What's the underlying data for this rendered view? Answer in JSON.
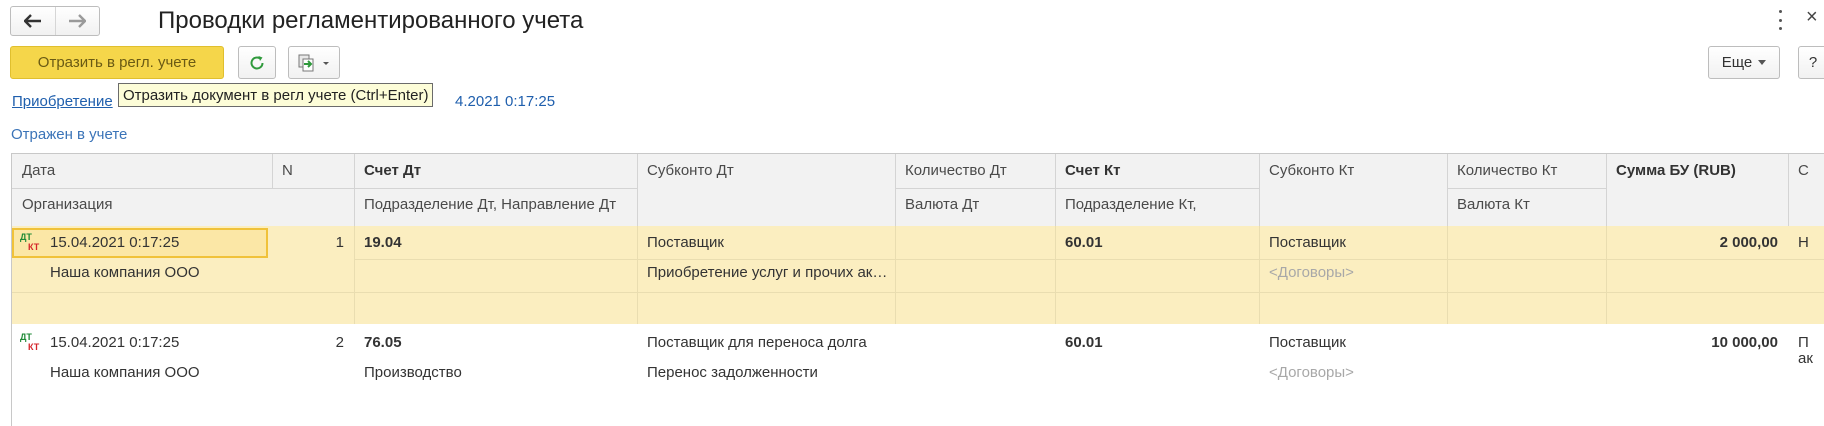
{
  "window": {
    "title": "Проводки регламентированного учета",
    "close_glyph": "×"
  },
  "toolbar": {
    "post_label": "Отразить в регл. учете",
    "more_label": "Еще",
    "help_label": "?"
  },
  "tooltip": "Отразить документ в регл учете (Ctrl+Enter)",
  "document_link": {
    "prefix": "Приобретение",
    "suffix": "4.2021 0:17:25"
  },
  "status": "Отражен в учете",
  "columns": {
    "date": "Дата",
    "n": "N",
    "debit_account": "Счет Дт",
    "debit_subconto": "Субконто Дт",
    "debit_qty": "Количество Дт",
    "credit_account": "Счет Кт",
    "credit_subconto": "Субконто Кт",
    "credit_qty": "Количество Кт",
    "amount": "Сумма БУ (RUB)",
    "extra": "С",
    "organization": "Организация",
    "debit_dept": "Подразделение Дт, Направление Дт",
    "debit_currency": "Валюта Дт",
    "credit_dept": "Подразделение Кт,",
    "credit_currency": "Валюта Кт"
  },
  "rows": [
    {
      "dtkt_dt": "ДТ",
      "dtkt_kt": "КТ",
      "date": "15.04.2021 0:17:25",
      "n": "1",
      "debit_account": "19.04",
      "organization": "Наша компания ООО",
      "debit_dept": "",
      "debit_subconto_1": "Поставщик",
      "debit_subconto_2": "Приобретение услуг и прочих ак…",
      "credit_account": "60.01",
      "credit_subconto_1": "Поставщик",
      "credit_subconto_2": "<Договоры>",
      "amount": "2 000,00",
      "extra": "Н"
    },
    {
      "dtkt_dt": "ДТ",
      "dtkt_kt": "КТ",
      "date": "15.04.2021 0:17:25",
      "n": "2",
      "debit_account": "76.05",
      "organization": "Наша компания ООО",
      "debit_dept": "Производство",
      "debit_subconto_1": "Поставщик для переноса долга",
      "debit_subconto_2": "Перенос задолженности",
      "credit_account": "60.01",
      "credit_subconto_1": "Поставщик",
      "credit_subconto_2": "<Договоры>",
      "amount": "10 000,00",
      "extra": "П",
      "extra_2": "ак"
    }
  ],
  "colors": {
    "accent_yellow": "#f5d64a",
    "selected_row": "#fbeec0",
    "link_blue": "#1f5fad"
  }
}
